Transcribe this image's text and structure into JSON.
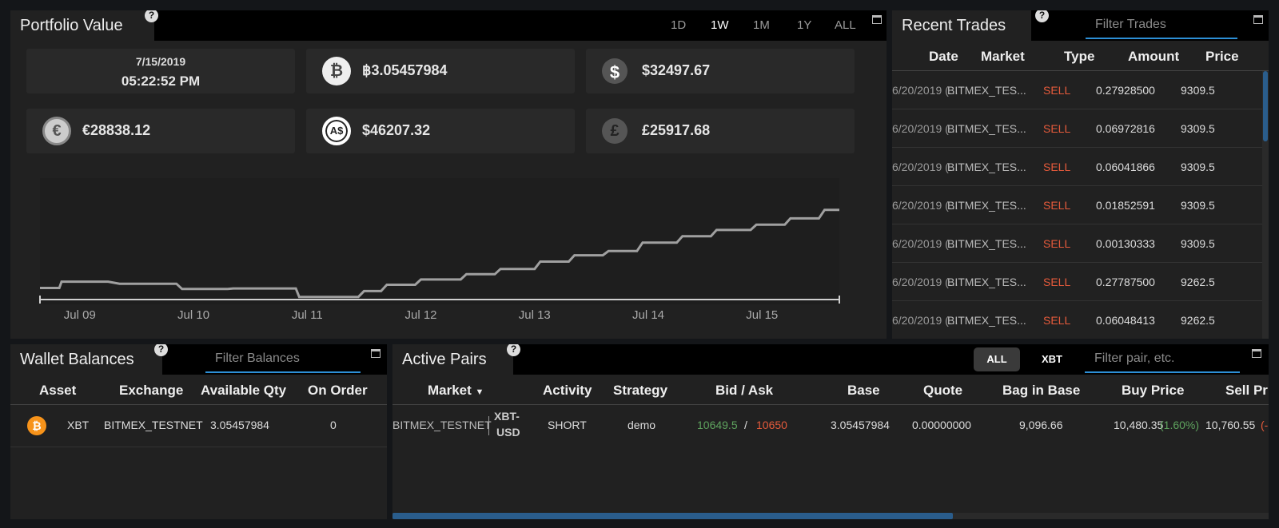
{
  "portfolio": {
    "title": "Portfolio Value",
    "ranges": [
      "1D",
      "1W",
      "1M",
      "1Y",
      "ALL"
    ],
    "active_range": "1W",
    "date": "7/15/2019",
    "time": "05:22:52 PM",
    "values": [
      {
        "icon": "bitcoin-icon",
        "symbol": "₿",
        "value": "฿3.05457984"
      },
      {
        "icon": "dollar-icon",
        "symbol": "$",
        "value": "$32497.67"
      },
      {
        "icon": "euro-icon",
        "symbol": "€",
        "value": "€28838.12"
      },
      {
        "icon": "aud-icon",
        "symbol": "A$",
        "value": "$46207.32"
      },
      {
        "icon": "pound-icon",
        "symbol": "£",
        "value": "£25917.68"
      }
    ]
  },
  "chart_data": {
    "type": "line",
    "x_ticks": [
      "Jul 09",
      "Jul 10",
      "Jul 11",
      "Jul 12",
      "Jul 13",
      "Jul 14",
      "Jul 15"
    ],
    "xlim": [
      8.65,
      15.68
    ],
    "ylim": [
      0,
      100
    ],
    "grid": false,
    "series": [
      {
        "x": [
          8.65,
          8.82,
          8.84,
          9.25,
          9.35,
          9.85,
          9.9,
          10.3,
          10.35,
          10.9,
          10.93,
          11.45,
          11.5,
          11.65,
          11.7,
          11.95,
          12.0,
          12.35,
          12.4,
          12.65,
          12.7,
          13.0,
          13.05,
          13.3,
          13.35,
          13.6,
          13.65,
          13.9,
          13.95,
          14.25,
          14.3,
          14.55,
          14.6,
          14.9,
          14.95,
          15.2,
          15.25,
          15.5,
          15.55,
          15.68
        ],
        "y": [
          11,
          11,
          17,
          17,
          15,
          15,
          10,
          10,
          10.5,
          10.5,
          2.5,
          2.5,
          8,
          8,
          14,
          14,
          19,
          19,
          24,
          24,
          29,
          29,
          36,
          36,
          42,
          42,
          46,
          46,
          54,
          54,
          60,
          60,
          66,
          66,
          71,
          71,
          77,
          77,
          85,
          85
        ]
      }
    ]
  },
  "trades": {
    "title": "Recent Trades",
    "filter_placeholder": "Filter Trades",
    "columns": [
      "Date",
      "Market",
      "Type",
      "Amount",
      "Price"
    ],
    "rows": [
      {
        "date": "6/20/2019 (...",
        "market": "BITMEX_TES...",
        "type": "SELL",
        "amount": "0.27928500",
        "price": "9309.5"
      },
      {
        "date": "6/20/2019 (...",
        "market": "BITMEX_TES...",
        "type": "SELL",
        "amount": "0.06972816",
        "price": "9309.5"
      },
      {
        "date": "6/20/2019 (...",
        "market": "BITMEX_TES...",
        "type": "SELL",
        "amount": "0.06041866",
        "price": "9309.5"
      },
      {
        "date": "6/20/2019 (...",
        "market": "BITMEX_TES...",
        "type": "SELL",
        "amount": "0.01852591",
        "price": "9309.5"
      },
      {
        "date": "6/20/2019 (...",
        "market": "BITMEX_TES...",
        "type": "SELL",
        "amount": "0.00130333",
        "price": "9309.5"
      },
      {
        "date": "6/20/2019 (...",
        "market": "BITMEX_TES...",
        "type": "SELL",
        "amount": "0.27787500",
        "price": "9262.5"
      },
      {
        "date": "6/20/2019 (...",
        "market": "BITMEX_TES...",
        "type": "SELL",
        "amount": "0.06048413",
        "price": "9262.5"
      }
    ]
  },
  "wallet": {
    "title": "Wallet Balances",
    "filter_placeholder": "Filter Balances",
    "columns": [
      "Asset",
      "Exchange",
      "Available Qty",
      "On Order"
    ],
    "row": {
      "asset": "XBT",
      "exchange": "BITMEX_TESTNET",
      "available": "3.05457984",
      "on_order": "0"
    }
  },
  "pairs": {
    "title": "Active Pairs",
    "toggle_all": "ALL",
    "toggle_xbt": "XBT",
    "filter_placeholder": "Filter pair, etc.",
    "columns": [
      "Market",
      "Activity",
      "Strategy",
      "Bid / Ask",
      "Base",
      "Quote",
      "Bag in Base",
      "Buy Price",
      "Sell Pri"
    ],
    "row": {
      "exchange": "BITMEX_TESTNET",
      "pair_line1": "XBT-",
      "pair_line2": "USD",
      "activity": "SHORT",
      "strategy": "demo",
      "bid": "10649.5",
      "bid_sep": "/",
      "ask": "10650",
      "base": "3.05457984",
      "quote": "0.00000000",
      "bag": "9,096.66",
      "buy_price": "10,480.35",
      "buy_pct": "(1.60%)",
      "sell_price": "10,760.55",
      "sell_pct": "(-"
    },
    "scroll_fraction": 0.64
  },
  "colors": {
    "accent": "#2d8fd6",
    "sell": "#e55a3b",
    "buy": "#5ea35e",
    "bitcoin": "#f7931a"
  }
}
